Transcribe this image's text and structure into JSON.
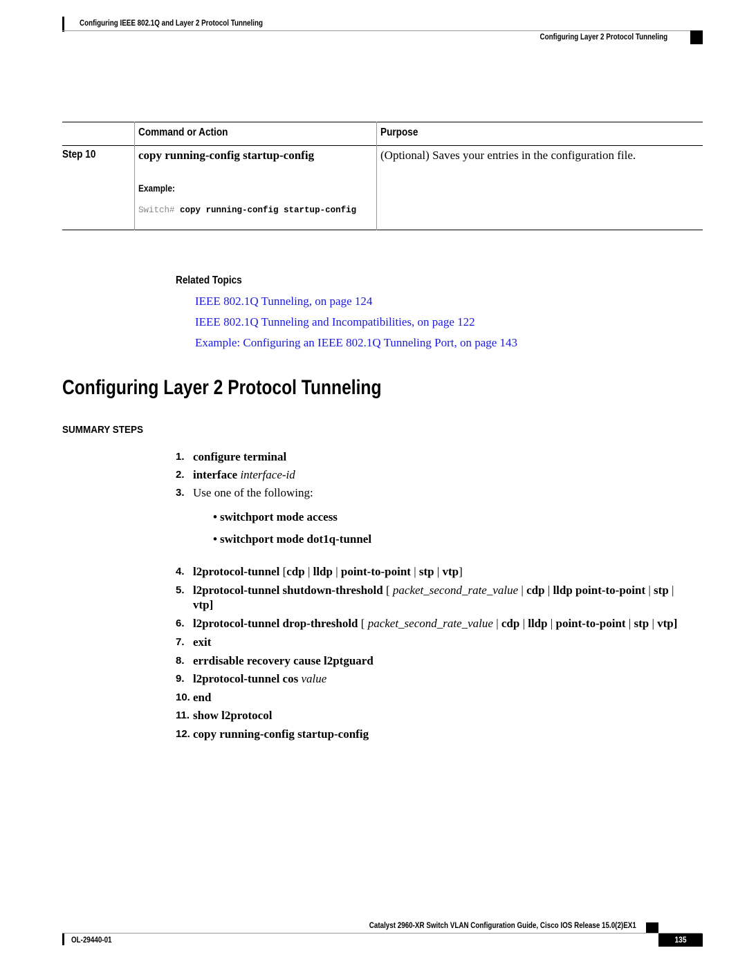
{
  "header": {
    "chapter_title": "Configuring IEEE 802.1Q and Layer 2 Protocol Tunneling",
    "section_title": "Configuring Layer 2 Protocol Tunneling"
  },
  "table": {
    "headers": [
      "",
      "Command or Action",
      "Purpose"
    ],
    "rows": [
      {
        "step": "Step 10",
        "command": "copy running-config startup-config",
        "example_label": "Example:",
        "example_prompt": "Switch#",
        "example_command": "copy running-config startup-config",
        "purpose": "(Optional) Saves your entries in the configuration file."
      }
    ]
  },
  "related_topics": {
    "title": "Related Topics",
    "links": [
      "IEEE 802.1Q Tunneling,  on page 124",
      "IEEE 802.1Q Tunneling and Incompatibilities,  on page 122",
      "Example: Configuring an IEEE 802.1Q Tunneling Port,  on page 143"
    ],
    "link_color": "#1a1adc"
  },
  "section": {
    "title": "Configuring Layer 2 Protocol Tunneling",
    "summary_label": "SUMMARY STEPS",
    "steps": [
      {
        "num": "1.",
        "parts": [
          {
            "t": "configure terminal",
            "s": "b"
          }
        ]
      },
      {
        "num": "2.",
        "parts": [
          {
            "t": "interface ",
            "s": "b"
          },
          {
            "t": "interface-id",
            "s": "i"
          }
        ]
      },
      {
        "num": "3.",
        "parts": [
          {
            "t": "Use one of the following:",
            "s": ""
          }
        ]
      },
      {
        "num": "4.",
        "parts": [
          {
            "t": "l2protocol-tunnel ",
            "s": "b"
          },
          {
            "t": "[",
            "s": ""
          },
          {
            "t": "cdp",
            "s": "b"
          },
          {
            "t": " | ",
            "s": ""
          },
          {
            "t": "lldp",
            "s": "b"
          },
          {
            "t": " | ",
            "s": ""
          },
          {
            "t": "point-to-point",
            "s": "b"
          },
          {
            "t": " | ",
            "s": ""
          },
          {
            "t": "stp",
            "s": "b"
          },
          {
            "t": " | ",
            "s": ""
          },
          {
            "t": "vtp",
            "s": "b"
          },
          {
            "t": "]",
            "s": ""
          }
        ]
      },
      {
        "num": "5.",
        "parts": [
          {
            "t": "l2protocol-tunnel shutdown-threshold ",
            "s": "b"
          },
          {
            "t": "[ ",
            "s": ""
          },
          {
            "t": "packet_second_rate_value",
            "s": "i"
          },
          {
            "t": " | ",
            "s": ""
          },
          {
            "t": "cdp",
            "s": "b"
          },
          {
            "t": " | ",
            "s": ""
          },
          {
            "t": "lldp point-to-point",
            "s": "b"
          },
          {
            "t": " | ",
            "s": ""
          },
          {
            "t": "stp",
            "s": "b"
          },
          {
            "t": " |",
            "s": ""
          }
        ],
        "continuation": "vtp]"
      },
      {
        "num": "6.",
        "parts": [
          {
            "t": "l2protocol-tunnel drop-threshold ",
            "s": "b"
          },
          {
            "t": "[ ",
            "s": ""
          },
          {
            "t": "packet_second_rate_value",
            "s": "i"
          },
          {
            "t": " | ",
            "s": ""
          },
          {
            "t": "cdp",
            "s": "b"
          },
          {
            "t": " | ",
            "s": ""
          },
          {
            "t": "lldp",
            "s": "b"
          },
          {
            "t": " | ",
            "s": ""
          },
          {
            "t": "point-to-point",
            "s": "b"
          },
          {
            "t": " | ",
            "s": ""
          },
          {
            "t": "stp",
            "s": "b"
          },
          {
            "t": " | ",
            "s": ""
          },
          {
            "t": "vtp]",
            "s": "b"
          }
        ]
      },
      {
        "num": "7.",
        "parts": [
          {
            "t": "exit",
            "s": "b"
          }
        ]
      },
      {
        "num": "8.",
        "parts": [
          {
            "t": "errdisable recovery cause l2ptguard",
            "s": "b"
          }
        ]
      },
      {
        "num": "9.",
        "parts": [
          {
            "t": "l2protocol-tunnel cos ",
            "s": "b"
          },
          {
            "t": "value",
            "s": "i"
          }
        ]
      },
      {
        "num": "10.",
        "parts": [
          {
            "t": "end",
            "s": "b"
          }
        ]
      },
      {
        "num": "11.",
        "parts": [
          {
            "t": "show l2protocol",
            "s": "b"
          }
        ]
      },
      {
        "num": "12.",
        "parts": [
          {
            "t": "copy running-config startup-config",
            "s": "b"
          }
        ]
      }
    ],
    "bullets": [
      "switchport mode access",
      "switchport mode dot1q-tunnel"
    ]
  },
  "footer": {
    "guide_title": "Catalyst 2960-XR Switch VLAN Configuration Guide, Cisco IOS Release 15.0(2)EX1",
    "doc_number": "OL-29440-01",
    "page_number": "135"
  }
}
